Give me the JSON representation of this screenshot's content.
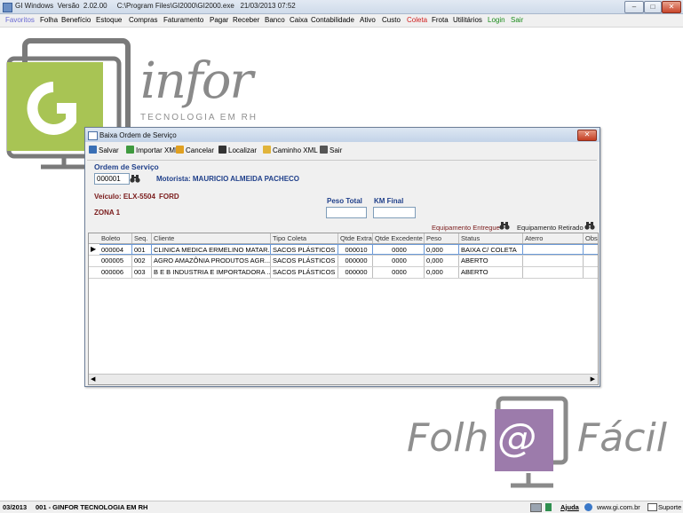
{
  "window": {
    "title": "GI Windows  Versão  2.02.00     C:\\Program Files\\GI2000\\GI2000.exe   21/03/2013 07:52",
    "minimize": "–",
    "maximize": "□",
    "close": "✕"
  },
  "menu": {
    "items": [
      {
        "label": "Favoritos",
        "color": "#6a6ad4"
      },
      {
        "label": "Folha",
        "color": "#000000"
      },
      {
        "label": "Benefício",
        "color": "#000000"
      },
      {
        "label": "Estoque",
        "color": "#000000"
      },
      {
        "label": "Compras",
        "color": "#000000"
      },
      {
        "label": "Faturamento",
        "color": "#000000"
      },
      {
        "label": "Pagar",
        "color": "#000000"
      },
      {
        "label": "Receber",
        "color": "#000000"
      },
      {
        "label": "Banco",
        "color": "#000000"
      },
      {
        "label": "Caixa",
        "color": "#000000"
      },
      {
        "label": "Contabilidade",
        "color": "#000000"
      },
      {
        "label": "Ativo",
        "color": "#000000"
      },
      {
        "label": "Custo",
        "color": "#000000"
      },
      {
        "label": "Coleta",
        "color": "#d11e1e"
      },
      {
        "label": "Frota",
        "color": "#000000"
      },
      {
        "label": "Utilitários",
        "color": "#000000"
      },
      {
        "label": "Login",
        "color": "#1a8a1a"
      },
      {
        "label": "Sair",
        "color": "#1a8a1a"
      }
    ]
  },
  "branding": {
    "infor_logo": "infor",
    "infor_tagline": "TECNOLOGIA EM RH",
    "g_letter": "G",
    "folha_left": "Folh",
    "folha_at": "@",
    "folha_right": "Fácil",
    "logo_green": "#a8c454",
    "logo_purple": "#9c7bab"
  },
  "dialog": {
    "title": "Baixa Ordem de Serviço",
    "close": "✕",
    "toolbar": [
      {
        "label": "Salvar",
        "icon": "save-icon",
        "color": "#3a6fb5"
      },
      {
        "label": "Importar XML",
        "icon": "import-xml-icon",
        "color": "#3f9a3f"
      },
      {
        "label": "Cancelar",
        "icon": "cancel-icon",
        "color": "#e0a020"
      },
      {
        "label": "Localizar",
        "icon": "binoculars-icon",
        "color": "#333333"
      },
      {
        "label": "Caminho XML",
        "icon": "folder-xml-icon",
        "color": "#e1b43a"
      },
      {
        "label": "Sair",
        "icon": "exit-icon",
        "color": "#555555"
      }
    ],
    "ordem_label": "Ordem de Serviço",
    "ordem_value": "000001",
    "motorista": "Motorista: MAURICIO ALMEIDA PACHECO",
    "veiculo": "Veículo: ELX-5504",
    "veiculo_marca": "FORD",
    "zona": "ZONA 1",
    "peso_total_label": "Peso Total",
    "km_final_label": "KM Final",
    "peso_total_value": "",
    "km_final_value": "",
    "equip_entregue": "Equipamento Entregue",
    "equip_retirado": "Equipamento Retirado"
  },
  "grid": {
    "columns": [
      "Boleto",
      "Seq.",
      "Cliente",
      "Tipo Coleta",
      "Qtde Extra",
      "Qtde Excedente",
      "Peso",
      "Status",
      "Aterro",
      "Obse"
    ],
    "rows": [
      [
        "000004",
        "001",
        "CLINICA MEDICA ERMELINO MATAR...",
        "SACOS PLÁSTICOS",
        "000010",
        "0000",
        "0,000",
        "BAIXA C/ COLETA",
        "",
        ""
      ],
      [
        "000005",
        "002",
        "AGRO AMAZÔNIA PRODUTOS AGR...",
        "SACOS PLÁSTICOS",
        "000000",
        "0000",
        "0,000",
        "ABERTO",
        "",
        ""
      ],
      [
        "000006",
        "003",
        "B E B INDUSTRIA E IMPORTADORA ...",
        "SACOS PLÁSTICOS",
        "000000",
        "0000",
        "0,000",
        "ABERTO",
        "",
        ""
      ]
    ],
    "current_row_marker": "▶",
    "scroll_left": "◀",
    "scroll_right": "▶"
  },
  "status": {
    "period": "03/2013",
    "company": "001 - GINFOR TECNOLOGIA EM RH",
    "help": "Ajuda",
    "site": "www.gi.com.br",
    "support": "Suporte"
  }
}
